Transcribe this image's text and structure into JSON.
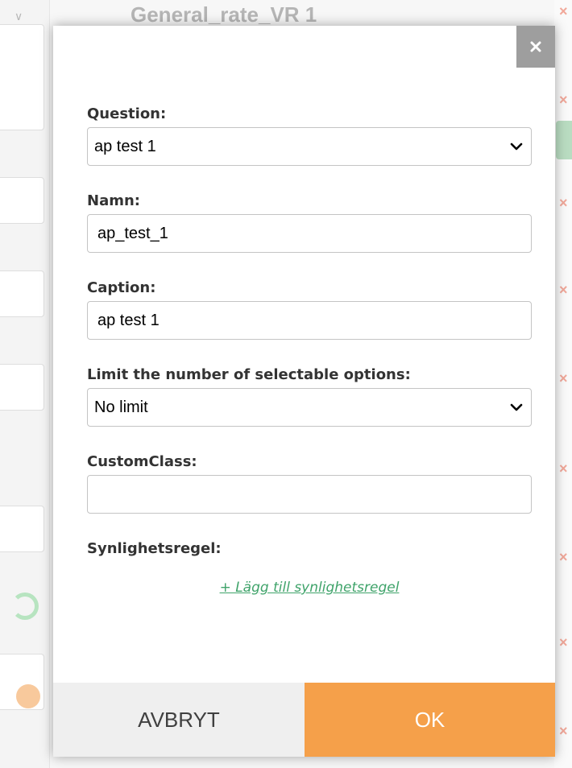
{
  "background": {
    "title": "General_rate_VR 1",
    "chevron_icon": "chevron-down-icon",
    "remove_icon": "close-icon"
  },
  "dialog": {
    "close_icon": "close-icon",
    "fields": {
      "question": {
        "label": "Question:",
        "value": "ap test 1"
      },
      "namn": {
        "label": "Namn:",
        "value": "ap_test_1"
      },
      "caption": {
        "label": "Caption:",
        "value": "ap test 1"
      },
      "limit": {
        "label": "Limit the number of selectable options:",
        "value": "No limit"
      },
      "custom_class": {
        "label": "CustomClass:",
        "value": ""
      },
      "visibility": {
        "label": "Synlighetsregel:",
        "add_link": "+ Lägg till synlighetsregel"
      }
    },
    "buttons": {
      "cancel": "AVBRYT",
      "ok": "OK"
    }
  },
  "colors": {
    "ok_button": "#f5a04a",
    "cancel_button": "#efefef",
    "link_green": "#3fa36a",
    "close_button": "#9e9e9e"
  }
}
